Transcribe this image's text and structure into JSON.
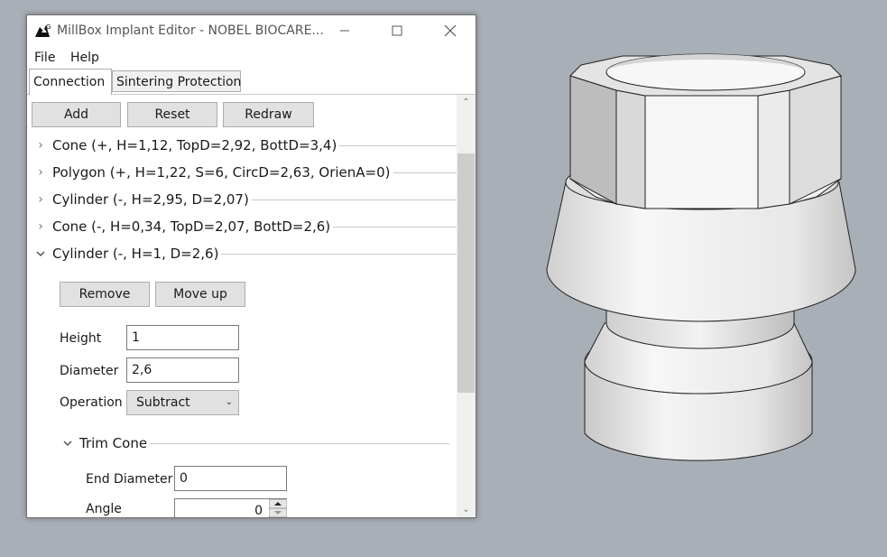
{
  "window": {
    "title": "MillBox Implant Editor -  NOBEL BIOCARE...",
    "minimize_icon": "minimize-icon",
    "maximize_icon": "maximize-icon",
    "close_icon": "close-icon"
  },
  "menu": {
    "file": "File",
    "help": "Help"
  },
  "tabs": {
    "connection": "Connection",
    "sintering": "Sintering Protection",
    "active": "Connection"
  },
  "toolbar": {
    "add": "Add",
    "reset": "Reset",
    "redraw": "Redraw"
  },
  "tree": [
    {
      "label": "Cone (+, H=1,12, TopD=2,92, BottD=3,4)",
      "expanded": false
    },
    {
      "label": "Polygon (+, H=1,22, S=6, CircD=2,63, OrienA=0)",
      "expanded": false
    },
    {
      "label": "Cylinder (-, H=2,95, D=2,07)",
      "expanded": false
    },
    {
      "label": "Cone (-, H=0,34, TopD=2,07, BottD=2,6)",
      "expanded": false
    },
    {
      "label": "Cylinder (-, H=1, D=2,6)",
      "expanded": true
    }
  ],
  "item_actions": {
    "remove": "Remove",
    "move_up": "Move up"
  },
  "form": {
    "height_label": "Height",
    "height_value": "1",
    "diameter_label": "Diameter",
    "diameter_value": "2,6",
    "operation_label": "Operation",
    "operation_value": "Subtract"
  },
  "trim_cone": {
    "label": "Trim Cone",
    "expanded": true,
    "end_diameter_label": "End Diameter",
    "end_diameter_value": "0",
    "angle_label": "Angle",
    "angle_value": "0"
  },
  "colors": {
    "viewport_bg": "#a9afb6",
    "button_bg": "#e1e1e1",
    "window_bg": "#ffffff"
  }
}
